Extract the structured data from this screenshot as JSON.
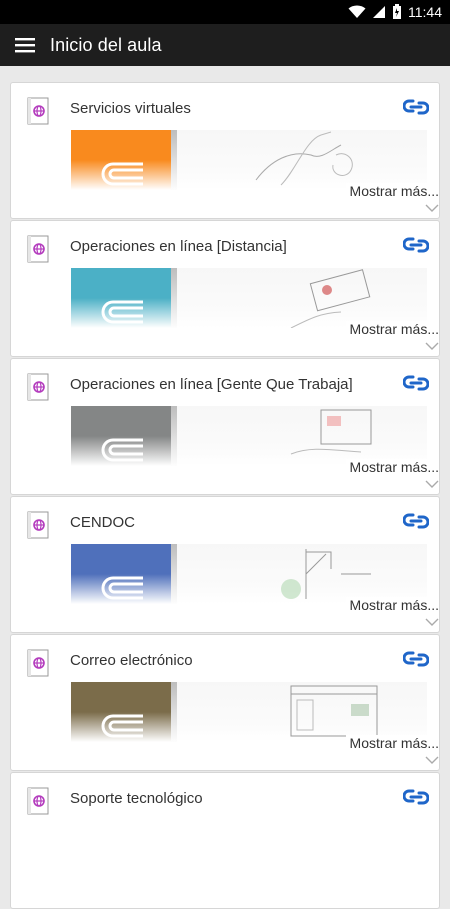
{
  "status_bar": {
    "time": "11:44"
  },
  "app_bar": {
    "title": "Inicio del aula"
  },
  "cards": [
    {
      "title": "Servicios virtuales",
      "more": "Mostrar más...",
      "color": "#f98a1e"
    },
    {
      "title": "Operaciones en línea [Distancia]",
      "more": "Mostrar más...",
      "color": "#4bb0c6"
    },
    {
      "title": "Operaciones en línea [Gente Que Trabaja]",
      "more": "Mostrar más...",
      "color": "#848686"
    },
    {
      "title": "CENDOC",
      "more": "Mostrar más...",
      "color": "#4f70bb"
    },
    {
      "title": "Correo electrónico",
      "more": "Mostrar más...",
      "color": "#7b6c4a"
    },
    {
      "title": "Soporte tecnológico",
      "more": "",
      "color": "#888888"
    }
  ],
  "colors": {
    "link_icon": "#1f66c9",
    "book_icon": "#b33bbd",
    "app_bar": "#1e1e1e"
  }
}
